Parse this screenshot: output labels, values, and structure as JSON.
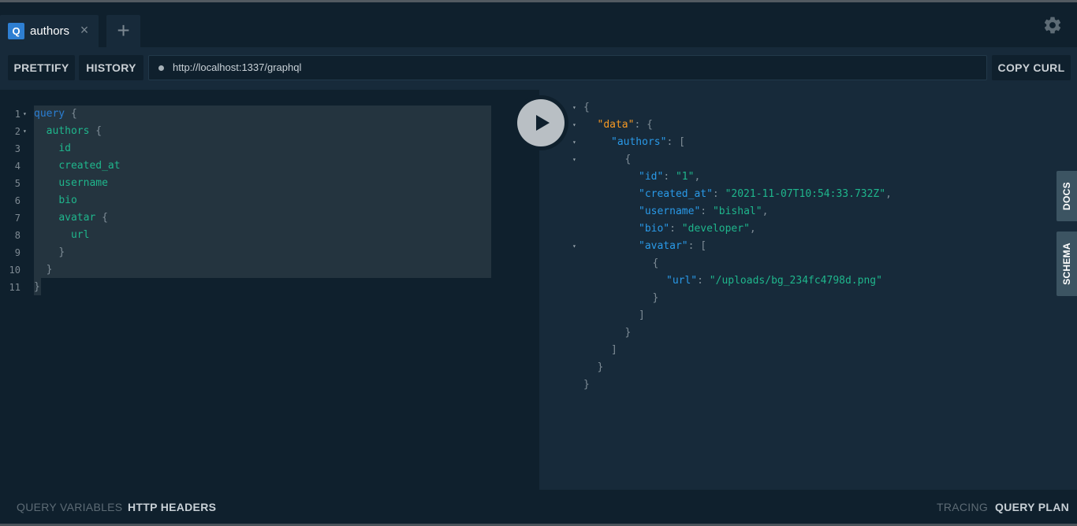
{
  "tabs": [
    {
      "badge": "Q",
      "title": "authors",
      "close": "×"
    }
  ],
  "add_tab": "+",
  "settings_icon": "gear-icon",
  "toolbar": {
    "prettify": "PRETTIFY",
    "history": "HISTORY",
    "endpoint": "http://localhost:1337/graphql",
    "copy_curl": "COPY CURL"
  },
  "editor": {
    "lines": [
      {
        "n": "1",
        "fold": "▾",
        "indent": "",
        "parts": [
          [
            "kw",
            "query"
          ],
          [
            "pn",
            " {"
          ]
        ]
      },
      {
        "n": "2",
        "fold": "▾",
        "indent": "  ",
        "parts": [
          [
            "fld",
            "authors"
          ],
          [
            "pn",
            " {"
          ]
        ]
      },
      {
        "n": "3",
        "fold": "",
        "indent": "    ",
        "parts": [
          [
            "fld",
            "id"
          ]
        ]
      },
      {
        "n": "4",
        "fold": "",
        "indent": "    ",
        "parts": [
          [
            "fld",
            "created_at"
          ]
        ]
      },
      {
        "n": "5",
        "fold": "",
        "indent": "    ",
        "parts": [
          [
            "fld",
            "username"
          ]
        ]
      },
      {
        "n": "6",
        "fold": "",
        "indent": "    ",
        "parts": [
          [
            "fld",
            "bio"
          ]
        ]
      },
      {
        "n": "7",
        "fold": "",
        "indent": "    ",
        "parts": [
          [
            "fld",
            "avatar"
          ],
          [
            "pn",
            " {"
          ]
        ]
      },
      {
        "n": "8",
        "fold": "",
        "indent": "      ",
        "parts": [
          [
            "fld",
            "url"
          ]
        ]
      },
      {
        "n": "9",
        "fold": "",
        "indent": "    ",
        "parts": [
          [
            "pn",
            "}"
          ]
        ]
      },
      {
        "n": "10",
        "fold": "",
        "indent": "  ",
        "parts": [
          [
            "pn",
            "}"
          ]
        ]
      },
      {
        "n": "11",
        "fold": "",
        "indent": "",
        "parts": [
          [
            "pn",
            "}"
          ]
        ]
      }
    ]
  },
  "result": {
    "lines": [
      {
        "fold": "▾",
        "indent": 0,
        "parts": [
          [
            "pn",
            "{"
          ]
        ]
      },
      {
        "fold": "▾",
        "indent": 1,
        "parts": [
          [
            "kt",
            "\"data\""
          ],
          [
            "pn",
            ": {"
          ]
        ]
      },
      {
        "fold": "▾",
        "indent": 2,
        "parts": [
          [
            "k",
            "\"authors\""
          ],
          [
            "pn",
            ": ["
          ]
        ]
      },
      {
        "fold": "▾",
        "indent": 3,
        "parts": [
          [
            "pn",
            "{"
          ]
        ]
      },
      {
        "fold": "",
        "indent": 4,
        "parts": [
          [
            "k",
            "\"id\""
          ],
          [
            "pn",
            ": "
          ],
          [
            "s",
            "\"1\""
          ],
          [
            "pn",
            ","
          ]
        ]
      },
      {
        "fold": "",
        "indent": 4,
        "parts": [
          [
            "k",
            "\"created_at\""
          ],
          [
            "pn",
            ": "
          ],
          [
            "s",
            "\"2021-11-07T10:54:33.732Z\""
          ],
          [
            "pn",
            ","
          ]
        ]
      },
      {
        "fold": "",
        "indent": 4,
        "parts": [
          [
            "k",
            "\"username\""
          ],
          [
            "pn",
            ": "
          ],
          [
            "s",
            "\"bishal\""
          ],
          [
            "pn",
            ","
          ]
        ]
      },
      {
        "fold": "",
        "indent": 4,
        "parts": [
          [
            "k",
            "\"bio\""
          ],
          [
            "pn",
            ": "
          ],
          [
            "s",
            "\"developer\""
          ],
          [
            "pn",
            ","
          ]
        ]
      },
      {
        "fold": "▾",
        "indent": 4,
        "parts": [
          [
            "k",
            "\"avatar\""
          ],
          [
            "pn",
            ": ["
          ]
        ]
      },
      {
        "fold": "",
        "indent": 5,
        "parts": [
          [
            "pn",
            "{"
          ]
        ]
      },
      {
        "fold": "",
        "indent": 6,
        "parts": [
          [
            "k",
            "\"url\""
          ],
          [
            "pn",
            ": "
          ],
          [
            "s",
            "\"/uploads/bg_234fc4798d.png\""
          ]
        ]
      },
      {
        "fold": "",
        "indent": 5,
        "parts": [
          [
            "pn",
            "}"
          ]
        ]
      },
      {
        "fold": "",
        "indent": 4,
        "parts": [
          [
            "pn",
            "]"
          ]
        ]
      },
      {
        "fold": "",
        "indent": 3,
        "parts": [
          [
            "pn",
            "}"
          ]
        ]
      },
      {
        "fold": "",
        "indent": 2,
        "parts": [
          [
            "pn",
            "]"
          ]
        ]
      },
      {
        "fold": "",
        "indent": 1,
        "parts": [
          [
            "pn",
            "}"
          ]
        ]
      },
      {
        "fold": "",
        "indent": 0,
        "parts": [
          [
            "pn",
            "}"
          ]
        ]
      }
    ]
  },
  "side_tabs": {
    "docs": "DOCS",
    "schema": "SCHEMA"
  },
  "bottom": {
    "query_variables": "QUERY VARIABLES",
    "http_headers": "HTTP HEADERS",
    "tracing": "TRACING",
    "query_plan": "QUERY PLAN"
  },
  "colors": {
    "background": "#172a3a",
    "panel": "#0f202d",
    "keyword": "#2a7ed3",
    "field": "#1fb68c",
    "data_key": "#f69923",
    "json_key": "#2a9ae8",
    "badge": "#2e7fd2"
  }
}
